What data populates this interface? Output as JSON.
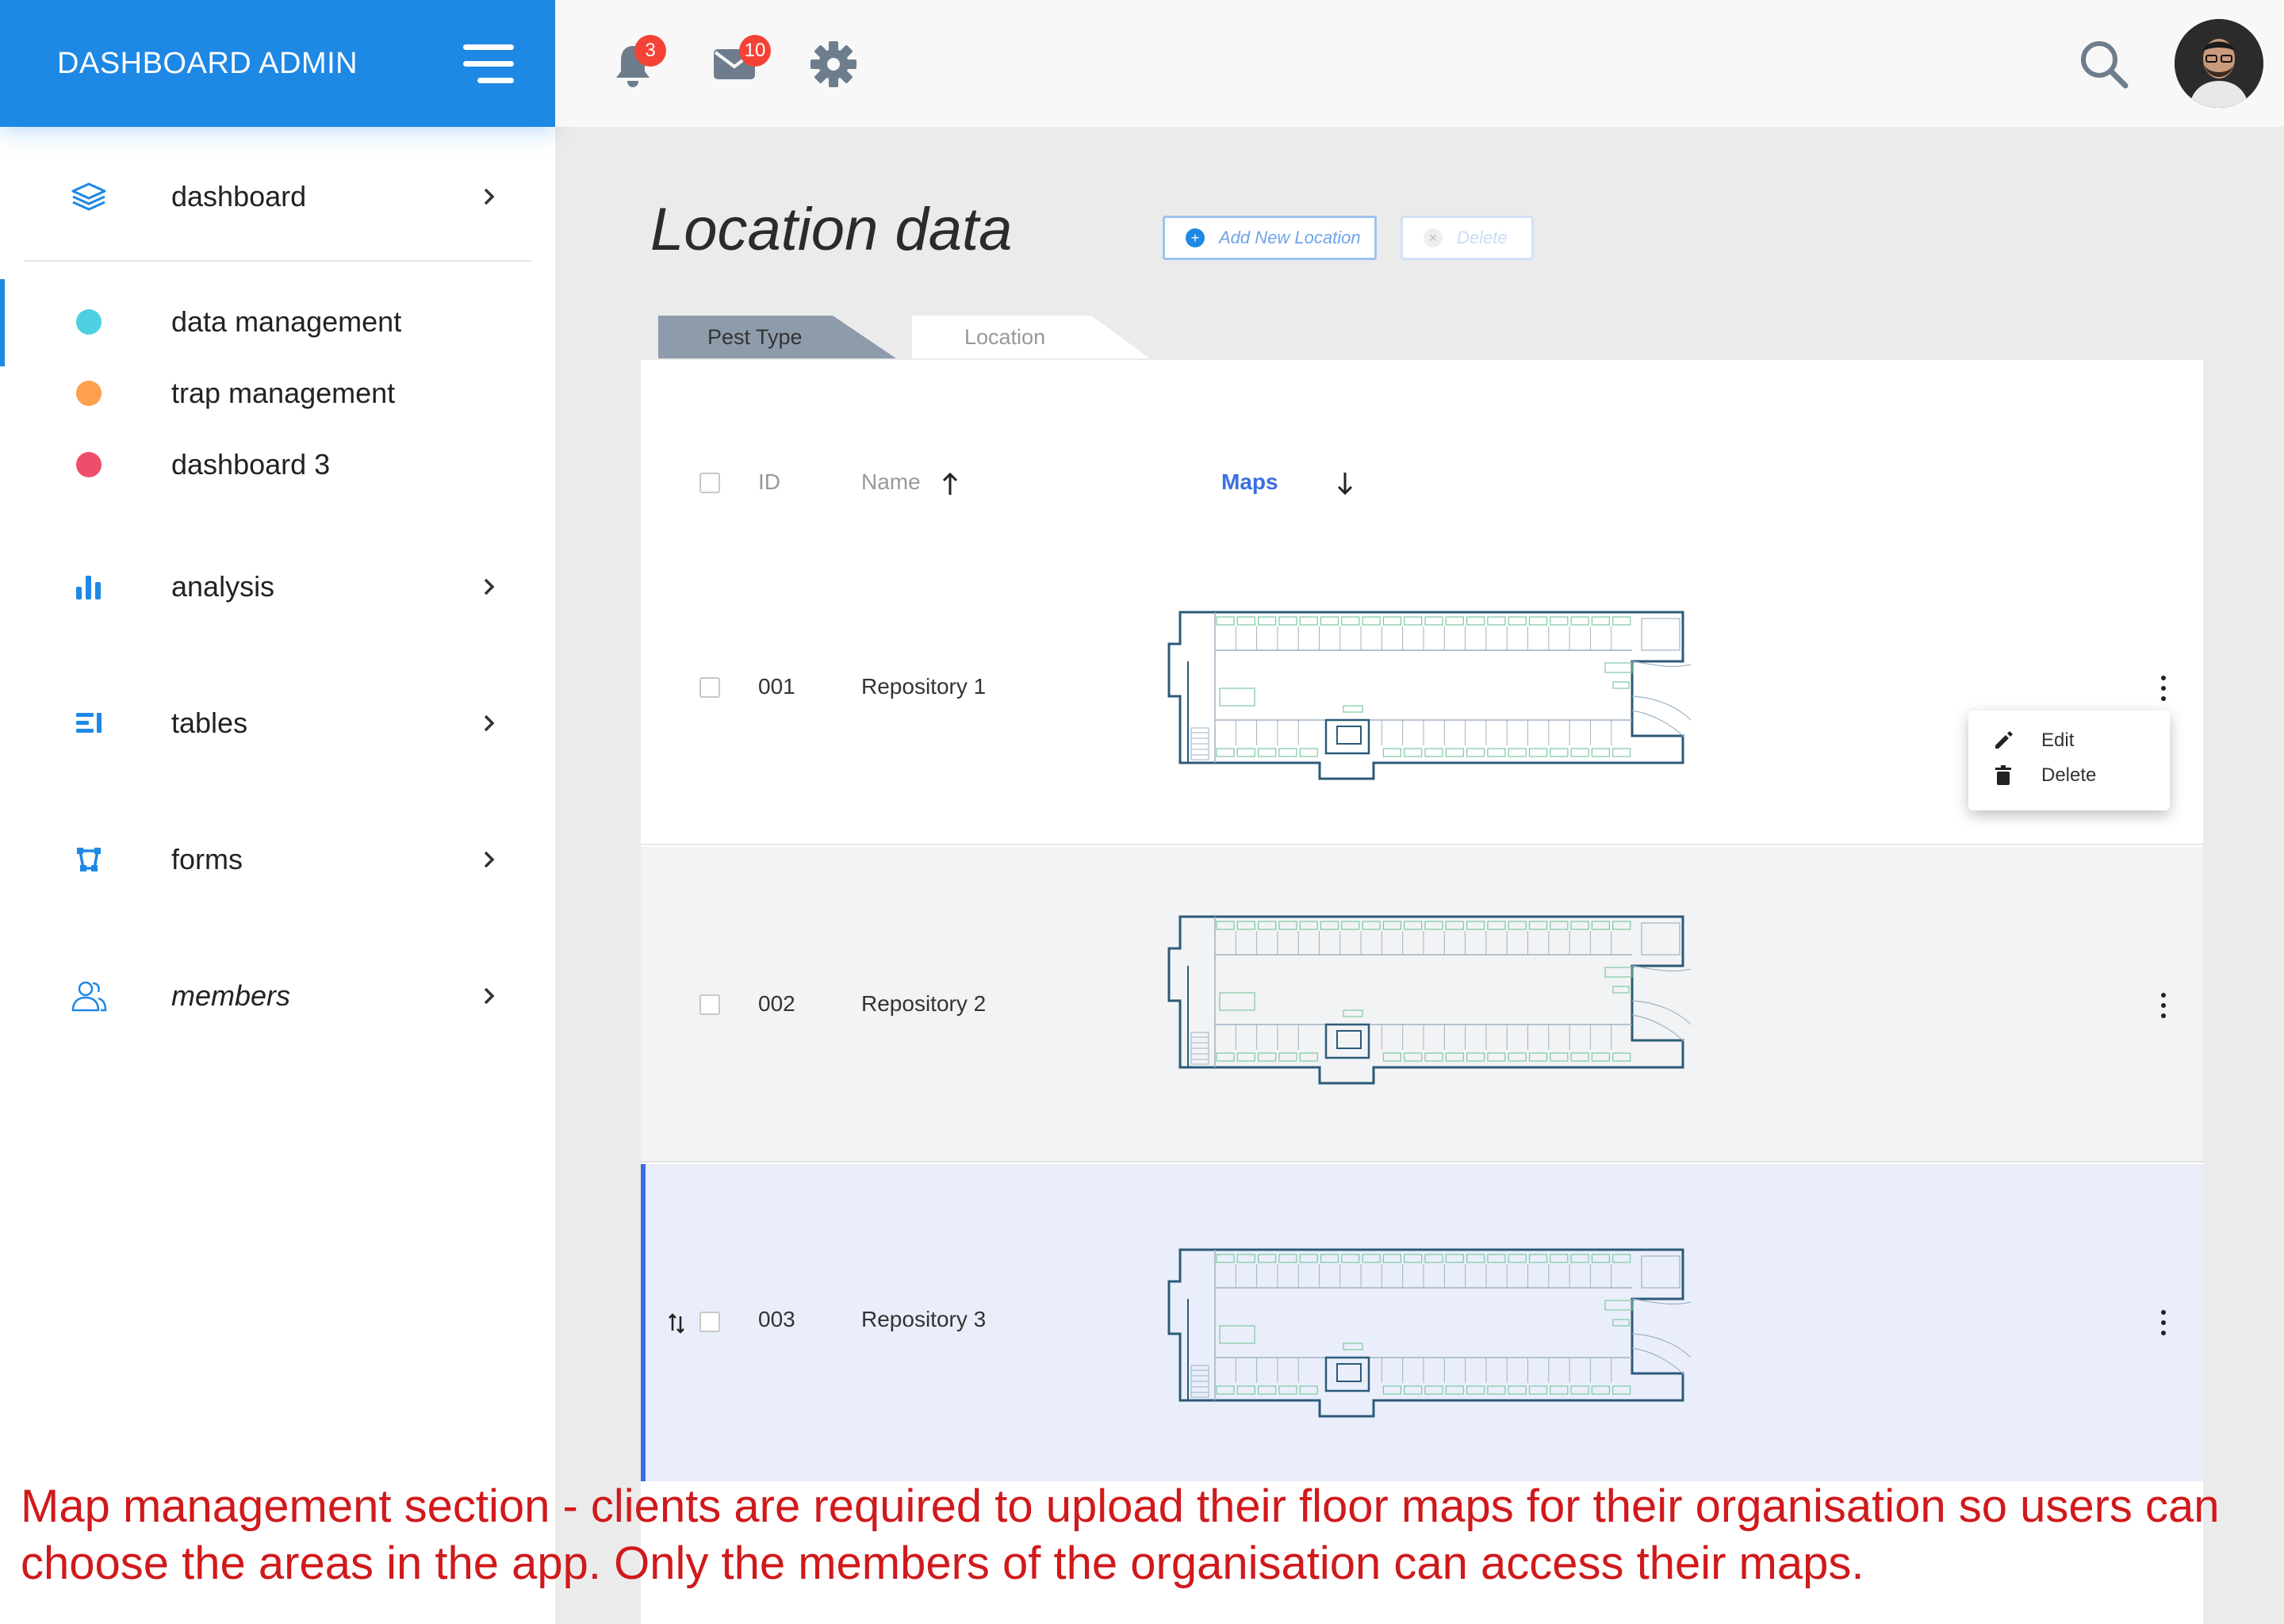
{
  "sidebar": {
    "brand": "DASHBOARD ADMIN",
    "items": [
      {
        "label": "dashboard",
        "icon": "layers-icon"
      },
      {
        "label": "data management",
        "icon": "dot-icon",
        "color": "#4dd0e1"
      },
      {
        "label": "trap management",
        "icon": "dot-icon",
        "color": "#ffa04d"
      },
      {
        "label": "dashboard 3",
        "icon": "dot-icon",
        "color": "#f04d6a"
      },
      {
        "label": "analysis",
        "icon": "bar-chart-icon"
      },
      {
        "label": "tables",
        "icon": "table-list-icon"
      },
      {
        "label": "forms",
        "icon": "vector-shape-icon"
      },
      {
        "label": "members",
        "icon": "users-icon"
      }
    ]
  },
  "topbar": {
    "notifications_count": "3",
    "messages_count": "10"
  },
  "page": {
    "title": "Location data",
    "add_button": "Add New Location",
    "delete_button": "Delete"
  },
  "tabs": [
    {
      "label": "Pest Type",
      "active": true
    },
    {
      "label": "Location",
      "active": false
    }
  ],
  "table": {
    "columns": {
      "id": "ID",
      "name": "Name",
      "maps": "Maps"
    },
    "rows": [
      {
        "id": "001",
        "name": "Repository 1"
      },
      {
        "id": "002",
        "name": "Repository 2"
      },
      {
        "id": "003",
        "name": "Repository 3"
      }
    ]
  },
  "context_menu": {
    "edit": "Edit",
    "delete": "Delete"
  },
  "annotation": "Map management section - clients are required to upload their floor maps for their organisation so users can choose the areas in the app. Only the members of the organisation can access their maps.",
  "colors": {
    "brand": "#1e88e5",
    "accent_link": "#3b6fe0",
    "badge": "#f44336",
    "annotation": "#d0191b"
  }
}
